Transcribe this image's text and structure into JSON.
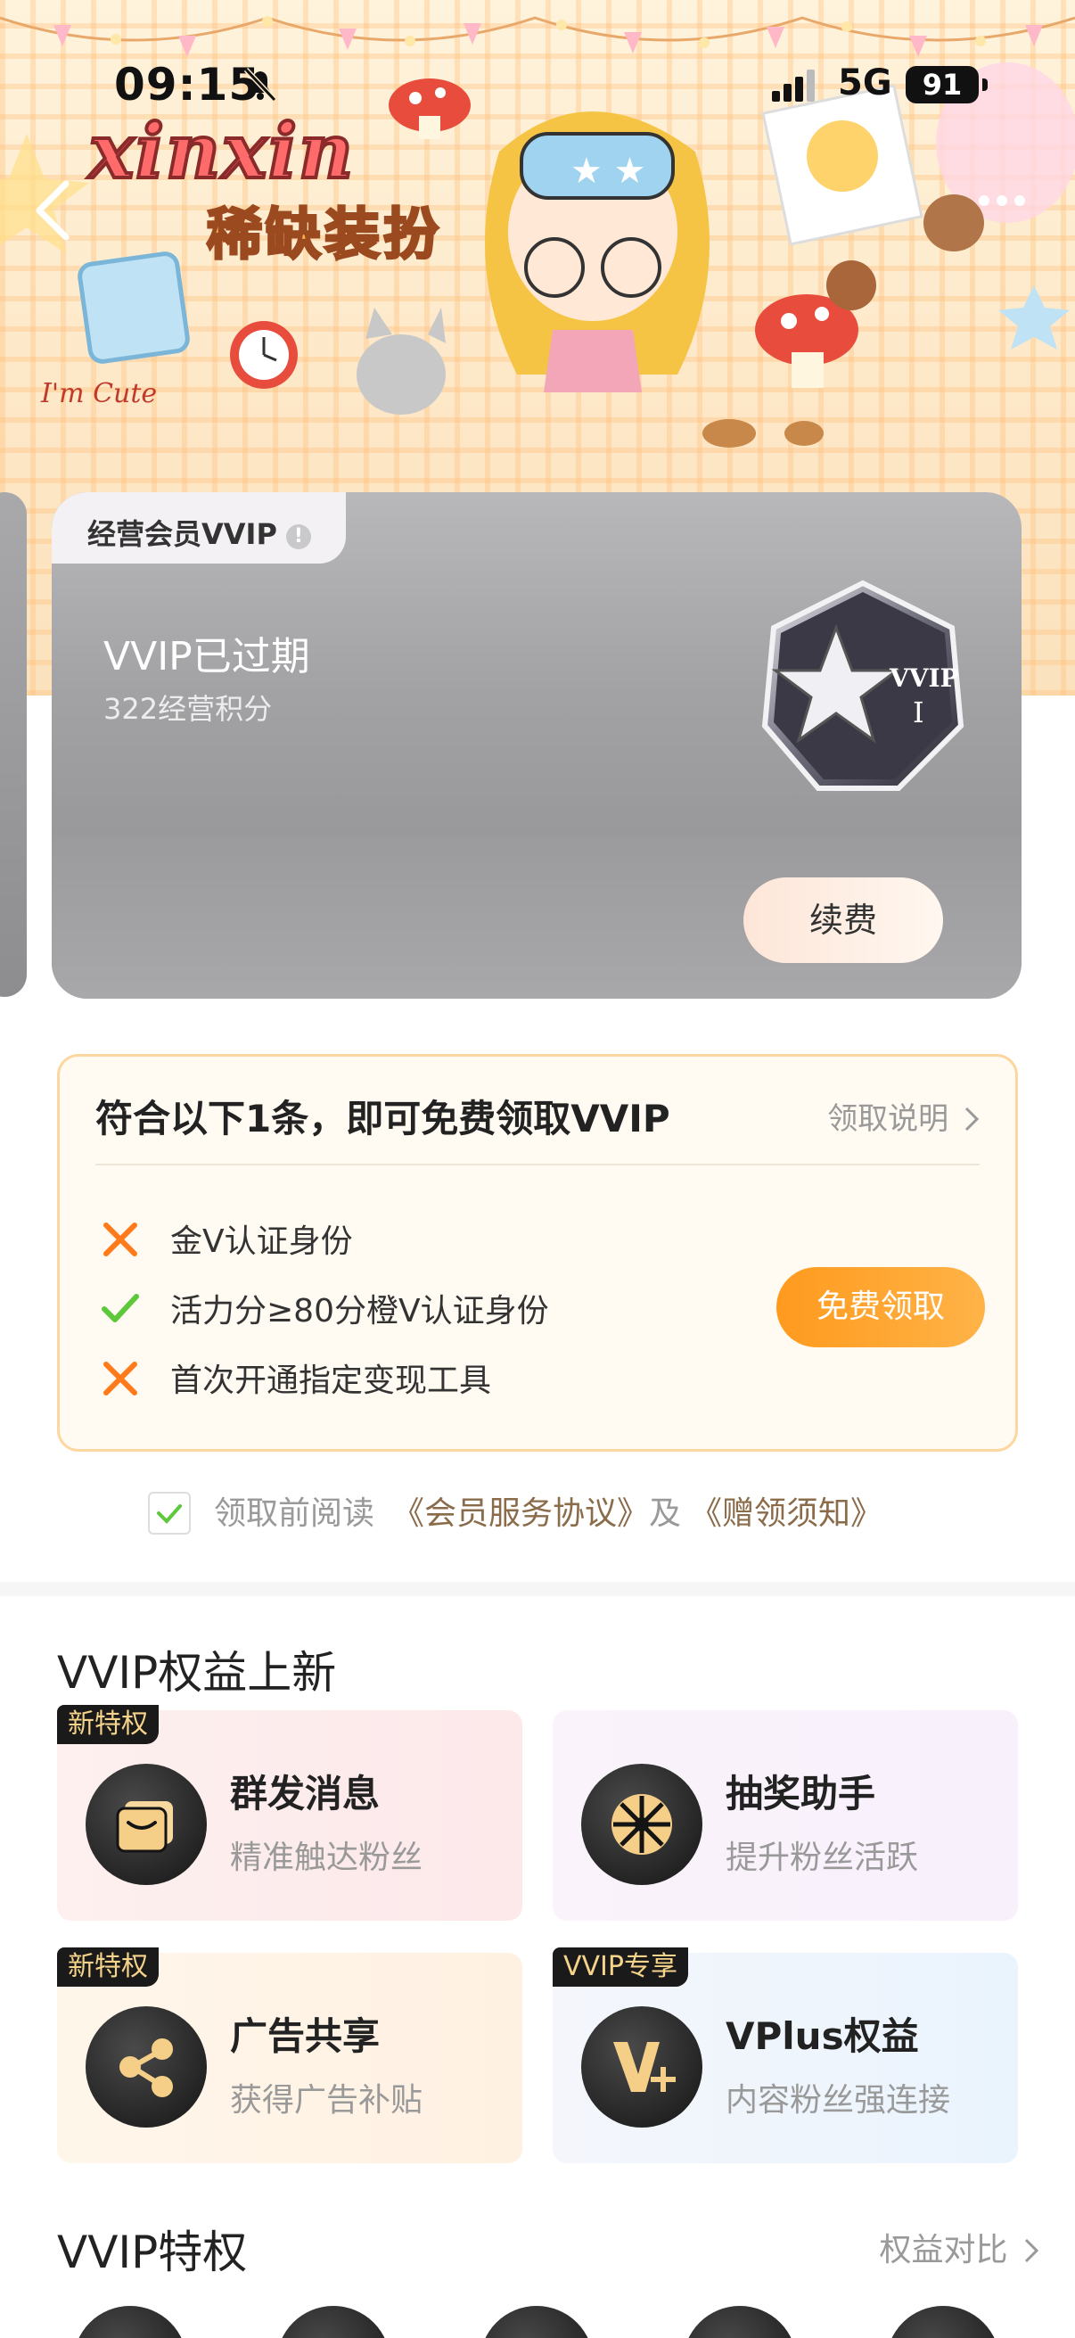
{
  "status_bar": {
    "time": "09:15",
    "network": "5G",
    "battery": "91"
  },
  "header": {
    "logo_text": "xinxin",
    "logo_subtitle": "稀缺装扮",
    "cute_text": "I'm Cute"
  },
  "member_card": {
    "tab_label": "经营会员VVIP",
    "status": "VVIP已过期",
    "points": "322经营积分",
    "badge_text": "VVIP",
    "badge_level": "I",
    "renew_label": "续费"
  },
  "claim": {
    "title": "符合以下1条，即可免费领取VVIP",
    "help_label": "领取说明",
    "conditions": [
      {
        "text": "金V认证身份",
        "met": false
      },
      {
        "text": "活力分≥80分橙V认证身份",
        "met": true
      },
      {
        "text": "首次开通指定变现工具",
        "met": false
      }
    ],
    "button_label": "免费领取"
  },
  "agreement": {
    "prefix": "领取前阅读",
    "link1": "《会员服务协议》",
    "joiner": "及",
    "link2": "《赠领须知》",
    "checked": true
  },
  "benefits_new": {
    "title": "VVIP权益上新",
    "items": [
      {
        "tag": "新特权",
        "name": "群发消息",
        "desc": "精准触达粉丝",
        "icon": "message-card-icon"
      },
      {
        "tag": "",
        "name": "抽奖助手",
        "desc": "提升粉丝活跃",
        "icon": "lottery-wheel-icon"
      },
      {
        "tag": "新特权",
        "name": "广告共享",
        "desc": "获得广告补贴",
        "icon": "share-icon"
      },
      {
        "tag": "VVIP专享",
        "name": "VPlus权益",
        "desc": "内容粉丝强连接",
        "icon": "vplus-icon"
      }
    ]
  },
  "privileges": {
    "title": "VVIP特权",
    "compare_label": "权益对比"
  },
  "colors": {
    "accent_orange": "#ff9a1e",
    "check_green": "#5cc83a",
    "cross_orange": "#ff7a1a",
    "link_brown": "#8a6b4a"
  }
}
